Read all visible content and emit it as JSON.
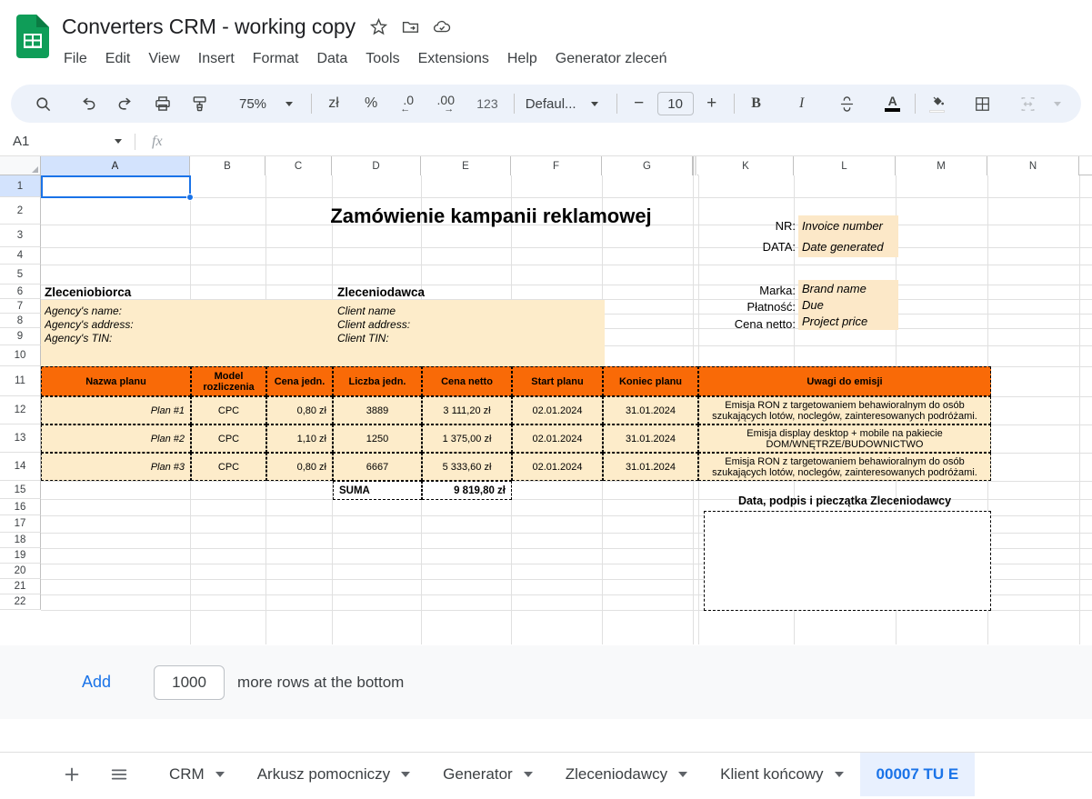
{
  "app": {
    "logo_icon": "sheets-logo-icon",
    "doc_title": "Converters CRM - working copy",
    "title_icons": [
      "star-icon",
      "move-to-folder-icon",
      "cloud-saved-icon"
    ],
    "menus": [
      "File",
      "Edit",
      "View",
      "Insert",
      "Format",
      "Data",
      "Tools",
      "Extensions",
      "Help",
      "Generator zleceń"
    ]
  },
  "toolbar": {
    "search_icon": "search-icon",
    "undo_icon": "undo-icon",
    "redo_icon": "redo-icon",
    "print_icon": "print-icon",
    "paint_format_icon": "paint-format-icon",
    "zoom_value": "75%",
    "zoom_caret_icon": "chevron-down-icon",
    "currency_label": "zł",
    "percent_label": "%",
    "decrease_decimal_label": ".0",
    "increase_decimal_label": ".00",
    "more_formats_label": "123",
    "font_name": "Defaul...",
    "font_caret_icon": "chevron-down-icon",
    "font_decrease_label": "−",
    "font_size": "10",
    "font_increase_label": "+",
    "bold_label": "B",
    "italic_label": "I",
    "strikethrough_icon": "strikethrough-icon",
    "text_color_label": "A",
    "fill_color_icon": "fill-color-icon",
    "borders_icon": "borders-icon",
    "merge_icon": "merge-cells-icon",
    "overflow_caret_icon": "chevron-down-icon"
  },
  "formula_bar": {
    "name_box": "A1",
    "name_caret_icon": "chevron-down-icon",
    "fx_label": "fx",
    "formula_value": ""
  },
  "grid": {
    "columns": [
      "A",
      "B",
      "C",
      "D",
      "E",
      "F",
      "G",
      "K",
      "L",
      "M",
      "N"
    ],
    "selected_column": "A",
    "rows": [
      "1",
      "2",
      "3",
      "4",
      "5",
      "6",
      "7",
      "8",
      "9",
      "10",
      "11",
      "12",
      "13",
      "14",
      "15",
      "16",
      "17",
      "18",
      "19",
      "20",
      "21",
      "22"
    ],
    "selected_row": "1",
    "selected_cell": "A1"
  },
  "document": {
    "heading": "Zamówienie kampanii reklamowej",
    "meta_left": [
      {
        "label": "NR:",
        "value": "Invoice number"
      },
      {
        "label": "DATA:",
        "value": "Date generated"
      }
    ],
    "meta_right": [
      {
        "label": "Marka:",
        "value": "Brand name"
      },
      {
        "label": "Płatność:",
        "value": "Due"
      },
      {
        "label": "Cena netto:",
        "value": "Project price"
      }
    ],
    "party_left_title": "Zleceniobiorca",
    "party_left_lines": [
      "Agency's name:",
      "Agency's address:",
      "Agency's TIN:"
    ],
    "party_right_title": "Zleceniodawca",
    "party_right_lines": [
      "Client name",
      "Client address:",
      "Client TIN:"
    ],
    "table_headers": [
      "Nazwa planu",
      "Model rozliczenia",
      "Cena jedn.",
      "Liczba jedn.",
      "Cena netto",
      "Start planu",
      "Koniec planu",
      "Uwagi do emisji"
    ],
    "table_rows": [
      {
        "plan": "Plan #1",
        "model": "CPC",
        "unit_price": "0,80 zł",
        "units": "3889",
        "net_price": "3 111,20 zł",
        "start": "02.01.2024",
        "end": "31.01.2024",
        "notes": "Emisja RON z targetowaniem behawioralnym do osób szukających lotów, noclegów, zainteresowanych podróżami."
      },
      {
        "plan": "Plan #2",
        "model": "CPC",
        "unit_price": "1,10 zł",
        "units": "1250",
        "net_price": "1 375,00 zł",
        "start": "02.01.2024",
        "end": "31.01.2024",
        "notes": "Emisja display desktop + mobile na pakiecie DOM/WNĘTRZE/BUDOWNICTWO"
      },
      {
        "plan": "Plan #3",
        "model": "CPC",
        "unit_price": "0,80 zł",
        "units": "6667",
        "net_price": "5 333,60 zł",
        "start": "02.01.2024",
        "end": "31.01.2024",
        "notes": "Emisja RON z targetowaniem behawioralnym do osób szukających lotów, noclegów, zainteresowanych podróżami."
      }
    ],
    "sum_label": "SUMA",
    "sum_value": "9 819,80 zł",
    "signature_title": "Data, podpis i pieczątka Zleceniodawcy",
    "colors": {
      "table_header_bg": "#f96a07",
      "table_row_bg": "#fdecca",
      "field_bg": "#fce8c8"
    }
  },
  "add_rows": {
    "link_label": "Add",
    "count": "1000",
    "suffix": "more rows at the bottom"
  },
  "sheet_tabs": {
    "add_icon": "plus-icon",
    "all_sheets_icon": "hamburger-menu-icon",
    "tabs": [
      {
        "label": "CRM",
        "active": false
      },
      {
        "label": "Arkusz pomocniczy",
        "active": false
      },
      {
        "label": "Generator",
        "active": false
      },
      {
        "label": "Zleceniodawcy",
        "active": false
      },
      {
        "label": "Klient końcowy",
        "active": false
      },
      {
        "label": "00007 TU E",
        "active": true
      }
    ]
  }
}
